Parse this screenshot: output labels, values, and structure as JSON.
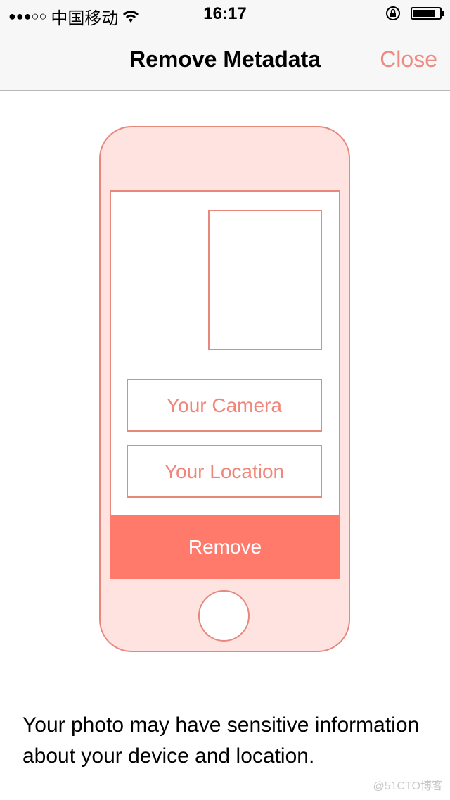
{
  "status_bar": {
    "signal": "●●●○○",
    "carrier": "中国移动",
    "time": "16:17",
    "battery_percent": 85
  },
  "nav": {
    "title": "Remove Metadata",
    "close_label": "Close"
  },
  "illustration": {
    "camera_label": "Your Camera",
    "location_label": "Your Location",
    "remove_label": "Remove"
  },
  "description": "Your photo may have sensitive information about your device and location.",
  "watermark": "@51CTO博客",
  "colors": {
    "accent": "#ff7a6a",
    "outline": "#e8877c",
    "phone_fill": "#ffe3e1",
    "close": "#f08a80"
  }
}
